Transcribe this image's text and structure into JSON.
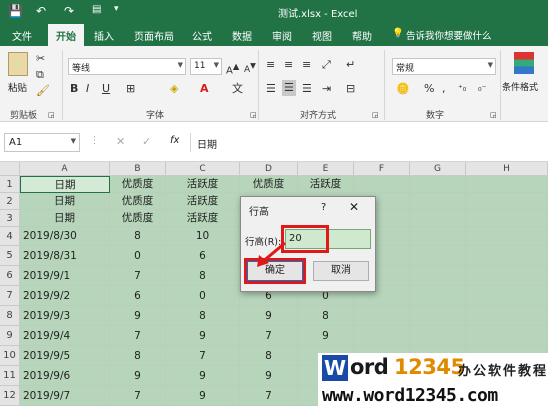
{
  "titlebar": {
    "qa_save": "💾",
    "qa_undo": "↶",
    "qa_redo": "↷",
    "doc_title": "测试.xlsx  -  Excel"
  },
  "tabs": [
    {
      "label": "文件"
    },
    {
      "label": "开始",
      "active": true
    },
    {
      "label": "插入"
    },
    {
      "label": "页面布局"
    },
    {
      "label": "公式"
    },
    {
      "label": "数据"
    },
    {
      "label": "审阅"
    },
    {
      "label": "视图"
    },
    {
      "label": "帮助"
    },
    {
      "label": "告诉我你想要做什么"
    }
  ],
  "ribbon": {
    "paste_label": "粘贴",
    "clipboard_label": "剪贴板",
    "font_name": "等线",
    "font_size": "11",
    "font_group_label": "字体",
    "align_group_label": "对齐方式",
    "number_format": "常规",
    "number_group_label": "数字",
    "cond_format_label": "条件格式"
  },
  "formula_bar": {
    "name_box": "A1",
    "fx": "fx",
    "content": "日期"
  },
  "grid": {
    "columns": [
      "A",
      "B",
      "C",
      "D",
      "E",
      "F",
      "G",
      "H"
    ],
    "rows": [
      {
        "n": "1",
        "cells": [
          "日期",
          "优质度",
          "活跃度",
          "优质度",
          "活跃度"
        ]
      },
      {
        "n": "2",
        "cells": [
          "日期",
          "优质度",
          "活跃度",
          "",
          ""
        ]
      },
      {
        "n": "3",
        "cells": [
          "日期",
          "优质度",
          "活跃度",
          "",
          ""
        ]
      },
      {
        "n": "4",
        "cells": [
          "2019/8/30",
          "8",
          "10",
          "",
          ""
        ]
      },
      {
        "n": "5",
        "cells": [
          "2019/8/31",
          "0",
          "6",
          "",
          ""
        ]
      },
      {
        "n": "6",
        "cells": [
          "2019/9/1",
          "7",
          "8",
          "",
          ""
        ]
      },
      {
        "n": "7",
        "cells": [
          "2019/9/2",
          "6",
          "0",
          "6",
          "0"
        ]
      },
      {
        "n": "8",
        "cells": [
          "2019/9/3",
          "9",
          "8",
          "9",
          "8"
        ]
      },
      {
        "n": "9",
        "cells": [
          "2019/9/4",
          "7",
          "9",
          "7",
          "9"
        ]
      },
      {
        "n": "10",
        "cells": [
          "2019/9/5",
          "8",
          "7",
          "8",
          ""
        ]
      },
      {
        "n": "11",
        "cells": [
          "2019/9/6",
          "9",
          "9",
          "9",
          ""
        ]
      },
      {
        "n": "12",
        "cells": [
          "2019/9/7",
          "7",
          "9",
          "7",
          ""
        ]
      }
    ]
  },
  "dialog": {
    "title": "行高",
    "help": "?",
    "close": "✕",
    "label": "行高(R):",
    "value": "20",
    "ok": "确定",
    "cancel": "取消"
  },
  "watermark": {
    "brand_w": "W",
    "brand_ord": "ord",
    "brand_num": "12345",
    "tagline": "办公软件教程",
    "url": "www.word12345.com"
  },
  "colors": {
    "excel_green": "#217346",
    "selection_fill": "#b7d5bb",
    "highlight_red": "#e01818"
  }
}
